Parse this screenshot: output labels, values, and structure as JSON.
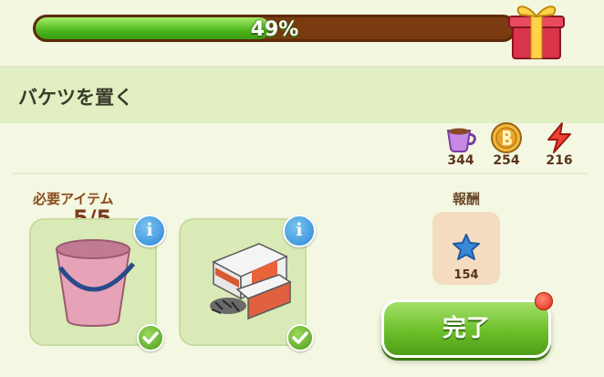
{
  "progress": {
    "label": "49%",
    "value": 0.49
  },
  "panel": {
    "title": "バケツを置く"
  },
  "resources": [
    {
      "name": "cup",
      "count": "344",
      "icon": "cup-icon"
    },
    {
      "name": "coin",
      "count": "254",
      "icon": "coin-icon"
    },
    {
      "name": "energy",
      "count": "216",
      "icon": "lightning-icon"
    }
  ],
  "requirements": {
    "label": "必要アイテム",
    "count": "5/5",
    "items": [
      {
        "icon": "bucket-icon",
        "info_label": "i"
      },
      {
        "icon": "nails-box-icon",
        "info_label": "i"
      }
    ]
  },
  "reward": {
    "label": "報酬",
    "count": "154",
    "icon": "star-icon"
  },
  "complete_button": {
    "label": "完了"
  },
  "colors": {
    "progress_fill": "#4db81c",
    "progress_track": "#7a3b10",
    "button": "#6cbf2a"
  }
}
